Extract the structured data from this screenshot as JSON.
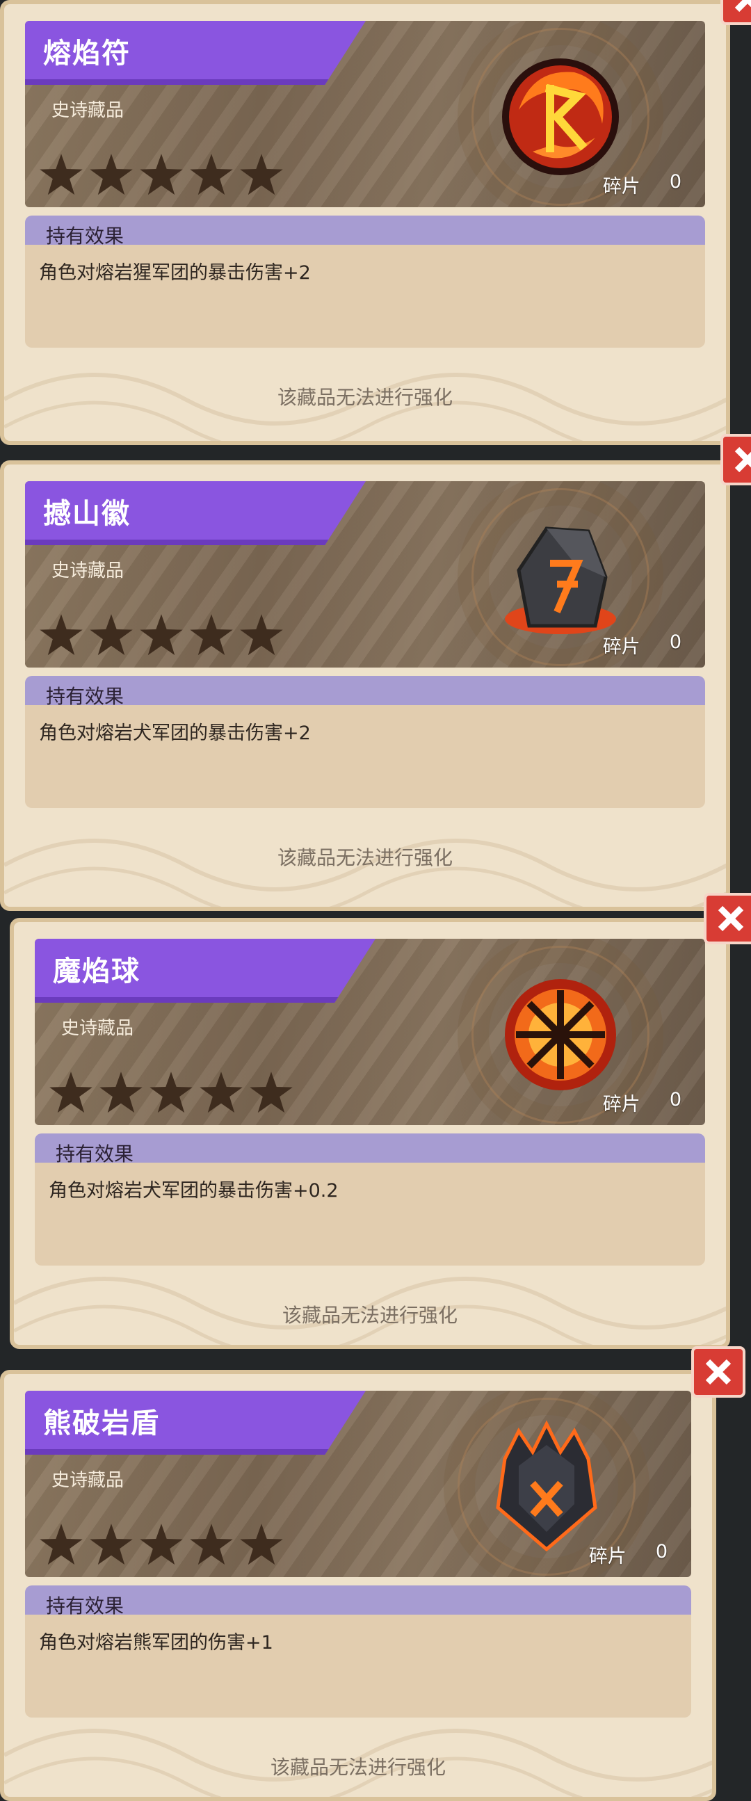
{
  "cards": [
    {
      "title": "熔焰符",
      "rarity": "史诗藏品",
      "stars": 5,
      "icon": "fire-rune-icon",
      "fragment_label": "碎片",
      "fragment_count": "0",
      "effect_header": "持有效果",
      "effect_text": "角色对熔岩猩军团的暴击伤害+2",
      "upgrade_note": "该藏品无法进行强化"
    },
    {
      "title": "撼山徽",
      "rarity": "史诗藏品",
      "stars": 5,
      "icon": "rock-emblem-icon",
      "fragment_label": "碎片",
      "fragment_count": "0",
      "effect_header": "持有效果",
      "effect_text": "角色对熔岩犬军团的暴击伤害+2",
      "upgrade_note": "该藏品无法进行强化"
    },
    {
      "title": "魔焰球",
      "rarity": "史诗藏品",
      "stars": 5,
      "icon": "flame-orb-icon",
      "fragment_label": "碎片",
      "fragment_count": "0",
      "effect_header": "持有效果",
      "effect_text": "角色对熔岩犬军团的暴击伤害+0.2",
      "upgrade_note": "该藏品无法进行强化"
    },
    {
      "title": "熊破岩盾",
      "rarity": "史诗藏品",
      "stars": 5,
      "icon": "spiked-shield-icon",
      "fragment_label": "碎片",
      "fragment_count": "0",
      "effect_header": "持有效果",
      "effect_text": "角色对熔岩熊军团的伤害+1",
      "upgrade_note": "该藏品无法进行强化"
    }
  ],
  "colors": {
    "banner": "#8a55e0",
    "effect_bar": "#a79cd2",
    "card_bg": "#efe2cb",
    "close": "#d83c34"
  }
}
